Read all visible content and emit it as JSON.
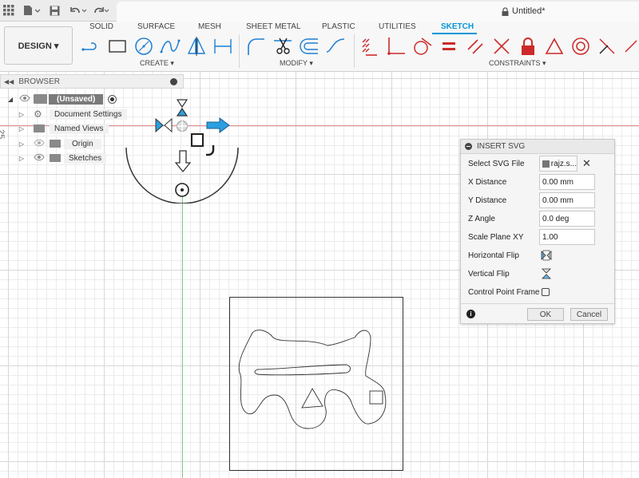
{
  "window": {
    "title": "Untitled*"
  },
  "workspace": {
    "button_label": "DESIGN ▾"
  },
  "tabs": [
    {
      "label": "SOLID",
      "active": false
    },
    {
      "label": "SURFACE",
      "active": false
    },
    {
      "label": "MESH",
      "active": false
    },
    {
      "label": "SHEET METAL",
      "active": false
    },
    {
      "label": "PLASTIC",
      "active": false
    },
    {
      "label": "UTILITIES",
      "active": false
    },
    {
      "label": "SKETCH",
      "active": true
    }
  ],
  "tool_groups": {
    "create": "CREATE ▾",
    "modify": "MODIFY ▾",
    "constraints": "CONSTRAINTS ▾"
  },
  "icons": {
    "create": [
      "line-icon",
      "rectangle-icon",
      "circle-icon",
      "spline-icon",
      "mirror-icon",
      "dimension-icon"
    ],
    "modify": [
      "fillet-icon",
      "trim-icon",
      "offset-icon",
      "fit-spline-icon"
    ],
    "constraints": [
      "horizontal-vertical-icon",
      "coincident-icon",
      "tangent-icon",
      "equal-icon",
      "parallel-icon",
      "perpendicular-icon",
      "fix-icon",
      "midpoint-icon",
      "concentric-icon",
      "collinear-icon",
      "symmetric-icon"
    ]
  },
  "browser": {
    "title": "BROWSER",
    "root": "(Unsaved)",
    "items": [
      {
        "label": "Document Settings"
      },
      {
        "label": "Named Views"
      },
      {
        "label": "Origin"
      },
      {
        "label": "Sketches"
      }
    ]
  },
  "canvas": {
    "ruler_value": "25"
  },
  "insert_svg": {
    "title": "INSERT SVG",
    "rows": [
      {
        "label": "Select SVG File",
        "value": "rajz.s..."
      },
      {
        "label": "X Distance",
        "value": "0.00 mm"
      },
      {
        "label": "Y Distance",
        "value": "0.00 mm"
      },
      {
        "label": "Z Angle",
        "value": "0.0 deg"
      },
      {
        "label": "Scale Plane XY",
        "value": "1.00"
      },
      {
        "label": "Horizontal Flip",
        "value": ""
      },
      {
        "label": "Vertical Flip",
        "value": ""
      },
      {
        "label": "Control Point Frame",
        "value": ""
      }
    ],
    "ok_label": "OK",
    "cancel_label": "Cancel"
  },
  "colors": {
    "accent": "#0696d7",
    "constraint_red": "#cc2a2a",
    "tool_blue": "#1f7fd1"
  }
}
